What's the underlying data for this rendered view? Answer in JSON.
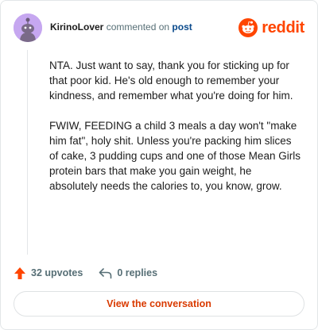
{
  "header": {
    "username": "KirinoLover",
    "meta_text": "commented on",
    "post_link": "post",
    "brand": "reddit"
  },
  "comment": {
    "paragraphs": [
      "NTA. Just want to say, thank you for sticking up for that poor kid. He's old enough to remember your kindness, and remember what you're doing for him.",
      "FWIW, FEEDING a child 3 meals a day won't \"make him fat\", holy shit. Unless you're packing him slices of cake, 3 pudding cups and one of those Mean Girls protein bars that make you gain weight, he absolutely needs the calories to, you know, grow."
    ]
  },
  "actions": {
    "upvotes": "32 upvotes",
    "replies": "0 replies"
  },
  "cta": {
    "label": "View the conversation"
  },
  "colors": {
    "brand": "#ff4500",
    "cta_text": "#d93a00",
    "link": "#0a4a8c",
    "avatar_bg": "#c6a7f0"
  },
  "icons": [
    "avatar",
    "reddit-logo-icon",
    "upvote-arrow-icon",
    "reply-arrow-icon"
  ]
}
